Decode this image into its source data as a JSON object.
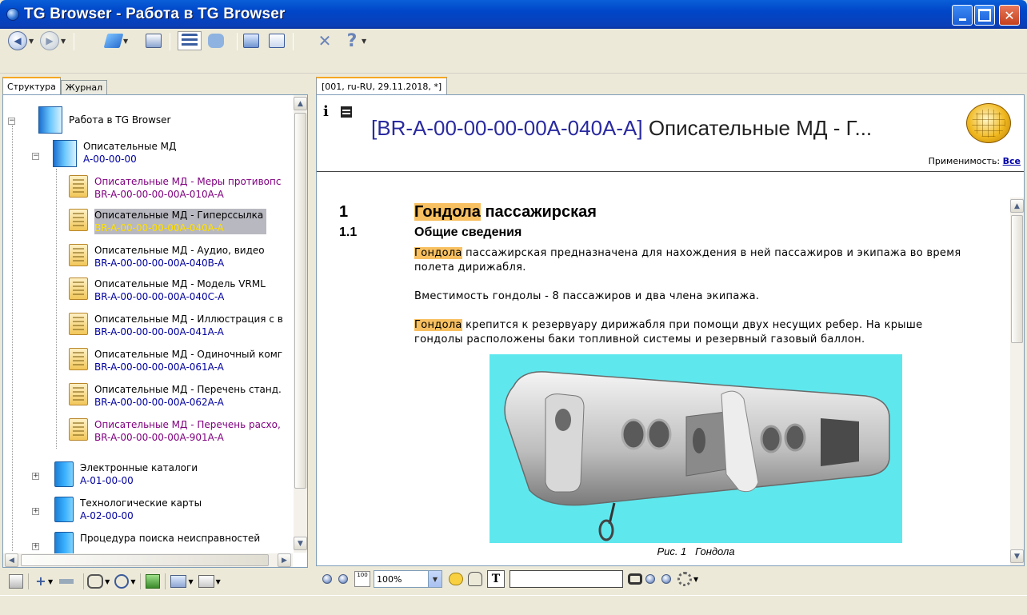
{
  "window": {
    "title": "TG Browser - Работа в TG Browser"
  },
  "toolbar": {
    "icons": [
      "back-icon",
      "forward-icon",
      "open-icon",
      "print-icon",
      "tree-view-icon",
      "comments-icon",
      "bookmark-icon",
      "find-in-doc-icon",
      "tools-icon",
      "help-icon"
    ]
  },
  "left_tabs": [
    {
      "label": "Структура",
      "active": true
    },
    {
      "label": "Журнал",
      "active": false
    }
  ],
  "tree": {
    "root": {
      "title": "Работа в TG Browser"
    },
    "group": {
      "title": "Описательные МД",
      "code": "A-00-00-00"
    },
    "items": [
      {
        "title": "Описательные МД - Меры противопс",
        "code": "BR-A-00-00-00-00A-010A-A",
        "state": "visited"
      },
      {
        "title": "Описательные МД - Гиперссылка",
        "code": "BR-A-00-00-00-00A-040A-A",
        "state": "selected"
      },
      {
        "title": "Описательные МД - Аудио, видео",
        "code": "BR-A-00-00-00-00A-040B-A",
        "state": "normal"
      },
      {
        "title": "Описательные МД - Модель VRML",
        "code": "BR-A-00-00-00-00A-040C-A",
        "state": "normal"
      },
      {
        "title": "Описательные МД - Иллюстрация с в",
        "code": "BR-A-00-00-00-00A-041A-A",
        "state": "normal"
      },
      {
        "title": "Описательные МД - Одиночный комг",
        "code": "BR-A-00-00-00-00A-061A-A",
        "state": "normal"
      },
      {
        "title": "Описательные МД - Перечень станд.",
        "code": "BR-A-00-00-00-00A-062A-A",
        "state": "normal"
      },
      {
        "title": "Описательные МД - Перечень расхо,",
        "code": "BR-A-00-00-00-00A-901A-A",
        "state": "visited"
      }
    ],
    "siblings": [
      {
        "title": "Электронные каталоги",
        "code": "A-01-00-00"
      },
      {
        "title": "Технологические карты",
        "code": "A-02-00-00"
      },
      {
        "title": "Процедура поиска неисправностей",
        "code": ""
      }
    ]
  },
  "doc_tab": {
    "label": "[001, ru-RU, 29.11.2018, *]"
  },
  "document": {
    "code": "[BR-A-00-00-00-00A-040A-A]",
    "title_rest": " Описательные МД - Г...",
    "applicability_label": "Применимость:",
    "applicability_value": "Все",
    "h1_num": "1",
    "h1_highlight": "Гондола",
    "h1_rest": " пассажирская",
    "h2_num": "1.1",
    "h2_text": "Общие сведения",
    "p1_highlight": "Гондола",
    "p1_rest": " пассажирская предназначена для нахождения в ней пассажиров и экипажа во время полета дирижабля.",
    "p2": "Вместимость гондолы - 8 пассажиров и два члена экипажа.",
    "p3_highlight": "Гондола",
    "p3_rest": " крепится к резервуару дирижабля при помощи двух несущих ребер. На крыше гондолы расположены баки топливной системы и резервный газовый баллон.",
    "figure_caption_num": "Рис. 1",
    "figure_caption_text": "Гондола"
  },
  "bottom_toolbar": {
    "zoom": "100%",
    "search_value": ""
  },
  "colors": {
    "highlight": "#f8c060",
    "figure_bg": "#5ee8ee",
    "title_bar": "#0046c8"
  }
}
